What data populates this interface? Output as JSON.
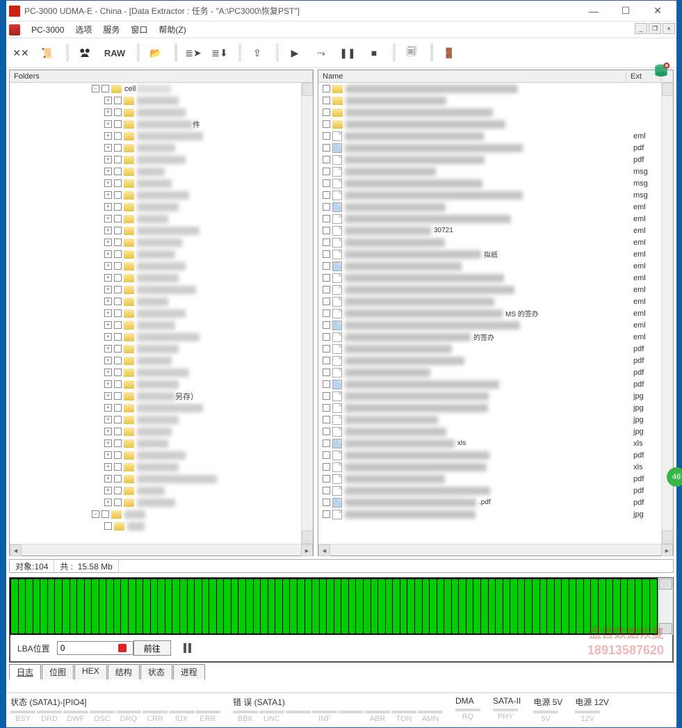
{
  "window": {
    "title": "PC-3000 UDMA-E - China - [Data Extractor : 任务 - \"A:\\PC3000\\恢复PST\"]"
  },
  "menu": {
    "app": "PC-3000",
    "items": [
      "选项",
      "服务",
      "窗口",
      "帮助(Z)"
    ]
  },
  "folders_header": "Folders",
  "files_header": {
    "name": "Name",
    "ext": "Ext"
  },
  "tree_sample": {
    "cell_label": "cell",
    "suffix1": "件",
    "suffix2": "另存）"
  },
  "file_fragments": {
    "f1": "30721",
    "f2": "拟纸",
    "f3": "MS 的签办",
    "f4": "的签办",
    "f5": "xls",
    "f6": ".pdf",
    "f7": ".jpg",
    "em": "eml",
    "pd": "pdf"
  },
  "ext_list": [
    "",
    "",
    "",
    "",
    "eml",
    "pdf",
    "pdf",
    "msg",
    "msg",
    "msg",
    "eml",
    "eml",
    "eml",
    "eml",
    "eml",
    "eml",
    "eml",
    "eml",
    "eml",
    "eml",
    "eml",
    "eml",
    "pdf",
    "pdf",
    "pdf",
    "pdf",
    "jpg",
    "jpg",
    "jpg",
    "jpg",
    "xls",
    "pdf",
    "xls",
    "pdf",
    "pdf",
    "pdf",
    "jpg"
  ],
  "status": {
    "objects_label": "对象:",
    "objects": "104",
    "total_label": "共 :",
    "total": "15.58 Mb"
  },
  "lba": {
    "label": "LBA位置",
    "value": "0",
    "go": "前往"
  },
  "tabs": [
    "日志",
    "位图",
    "HEX",
    "结构",
    "状态",
    "进程"
  ],
  "watermark": {
    "line1": "盘首数据恢复",
    "line2": "18913587620"
  },
  "groups": {
    "state": {
      "title": "状态 (SATA1)-[PIO4]",
      "items": [
        "BSY",
        "DRD",
        "DWF",
        "DSC",
        "DRQ",
        "CRR",
        "IDX",
        "ERR"
      ]
    },
    "error": {
      "title": "错 误 (SATA1)",
      "items": [
        "BBK",
        "UNC",
        "",
        "INF",
        "",
        "ABR",
        "TON",
        "AMN"
      ]
    },
    "dma": {
      "title": "DMA",
      "items": [
        "RQ"
      ]
    },
    "sata2": {
      "title": "SATA-II",
      "items": [
        "PHY"
      ]
    },
    "pw5": {
      "title": "电源 5V",
      "items": [
        "5V"
      ]
    },
    "pw12": {
      "title": "电源 12V",
      "items": [
        "12V"
      ]
    }
  },
  "badge": "46"
}
